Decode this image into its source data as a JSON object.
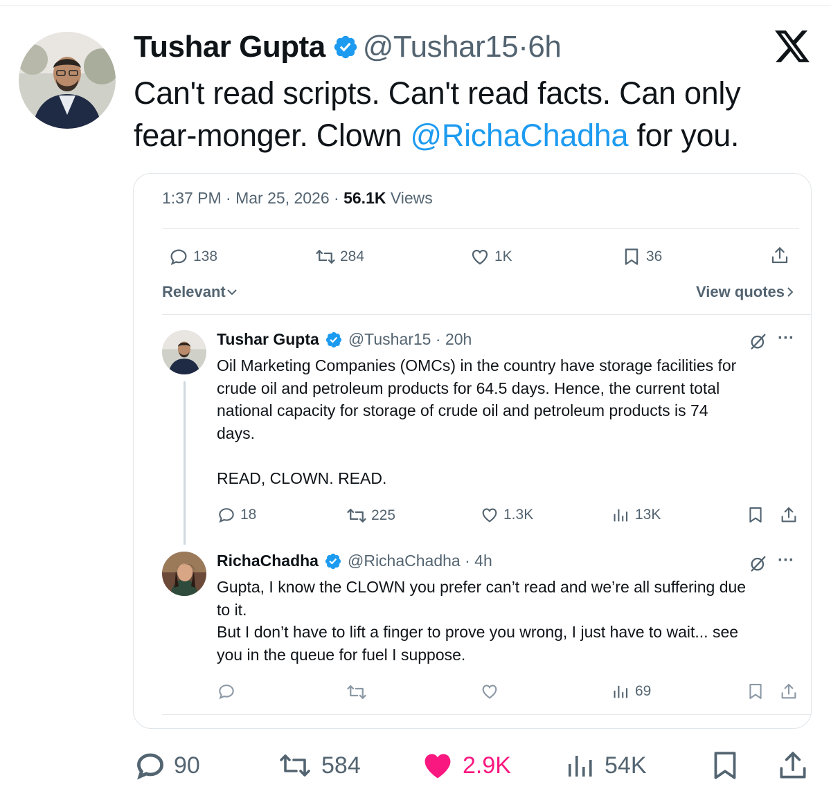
{
  "tweet": {
    "author_name": "Tushar Gupta",
    "author_handle": "@Tushar15",
    "time": "6h",
    "text_part1": "Can't read scripts. Can't read facts. Can only",
    "text_part2": "fear-monger. Clown ",
    "mention": "@RichaChadha",
    "text_part3": " for you.",
    "stats": {
      "replies": "90",
      "retweets": "584",
      "likes": "2.9K",
      "views": "54K"
    }
  },
  "quoted": {
    "time": "1:37 PM",
    "date": "Mar 25, 2026",
    "views_count": "56.1K",
    "views_label": "Views",
    "stats": {
      "replies": "138",
      "retweets": "284",
      "likes": "1K",
      "bookmarks": "36"
    },
    "sort_label": "Relevant",
    "view_quotes_label": "View quotes",
    "replies": [
      {
        "name": "Tushar Gupta",
        "handle": "@Tushar15",
        "time": "20h",
        "text": "Oil Marketing Companies (OMCs) in the country have storage facilities for\ncrude oil and petroleum products for 64.5 days. Hence, the current total\nnational capacity for storage of crude oil and petroleum products is 74\ndays.\n\nREAD, CLOWN. READ.",
        "stats": {
          "replies": "18",
          "retweets": "225",
          "likes": "1.3K",
          "views": "13K"
        }
      },
      {
        "name": "RichaChadha",
        "handle": "@RichaChadha",
        "time": "4h",
        "text": "Gupta, I know the CLOWN you prefer can’t read and we’re all suffering due\nto it.\nBut I don’t have to lift a finger to prove you wrong, I just have to wait... see\nyou in the queue for fuel I suppose.",
        "stats": {
          "replies": "",
          "retweets": "",
          "likes": "",
          "views": "69"
        }
      }
    ]
  },
  "colors": {
    "accent": "#1d9bf0",
    "like": "#f91880",
    "muted": "#536471"
  }
}
